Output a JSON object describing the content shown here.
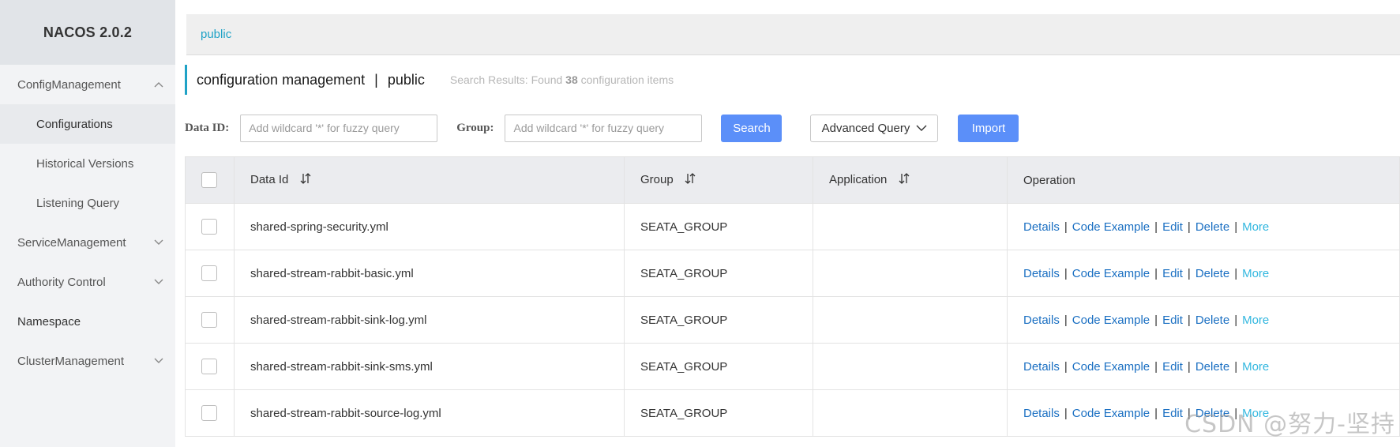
{
  "app": {
    "brand": "NACOS 2.0.2"
  },
  "sidebar": {
    "items": [
      {
        "label": "ConfigManagement",
        "expanded": true
      },
      {
        "label": "Configurations",
        "active": true
      },
      {
        "label": "Historical Versions"
      },
      {
        "label": "Listening Query"
      },
      {
        "label": "ServiceManagement",
        "expanded": false
      },
      {
        "label": "Authority Control",
        "expanded": false
      },
      {
        "label": "Namespace"
      },
      {
        "label": "ClusterManagement",
        "expanded": false
      }
    ]
  },
  "breadcrumb": {
    "namespace": "public"
  },
  "header": {
    "title": "configuration management",
    "separator": "|",
    "namespace": "public",
    "results_prefix": "Search Results: Found",
    "results_count": "38",
    "results_suffix": "configuration items"
  },
  "filters": {
    "data_id_label": "Data ID:",
    "data_id_placeholder": "Add wildcard '*' for fuzzy query",
    "group_label": "Group:",
    "group_placeholder": "Add wildcard '*' for fuzzy query",
    "search_label": "Search",
    "advanced_label": "Advanced Query",
    "import_label": "Import"
  },
  "table": {
    "columns": [
      "Data Id",
      "Group",
      "Application",
      "Operation"
    ],
    "rows": [
      {
        "data_id": "shared-spring-security.yml",
        "group": "SEATA_GROUP",
        "application": ""
      },
      {
        "data_id": "shared-stream-rabbit-basic.yml",
        "group": "SEATA_GROUP",
        "application": ""
      },
      {
        "data_id": "shared-stream-rabbit-sink-log.yml",
        "group": "SEATA_GROUP",
        "application": ""
      },
      {
        "data_id": "shared-stream-rabbit-sink-sms.yml",
        "group": "SEATA_GROUP",
        "application": ""
      },
      {
        "data_id": "shared-stream-rabbit-source-log.yml",
        "group": "SEATA_GROUP",
        "application": ""
      }
    ],
    "operations": {
      "details": "Details",
      "code_example": "Code Example",
      "edit": "Edit",
      "delete": "Delete",
      "more": "More",
      "sep": "|"
    }
  },
  "watermark": "CSDN @努力-坚持",
  "colors": {
    "accent": "#1fa2c6",
    "primary_button": "#5b8ff9",
    "link": "#1a6fc2",
    "more_link": "#33b7df"
  }
}
